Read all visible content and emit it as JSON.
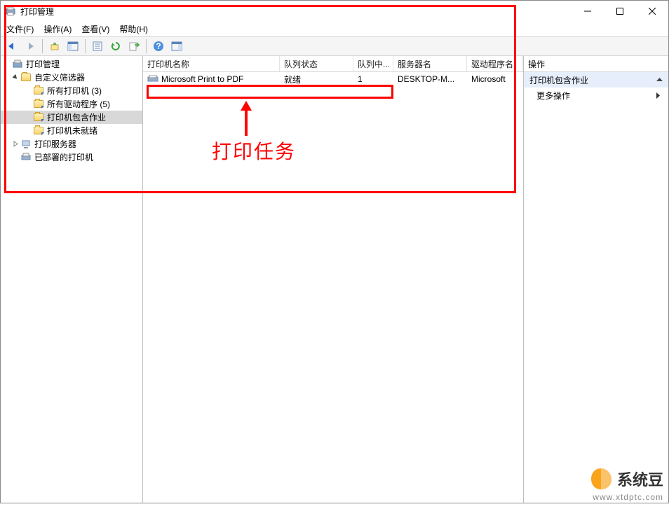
{
  "window": {
    "title": "打印管理"
  },
  "menu": {
    "file": "文件(F)",
    "action": "操作(A)",
    "view": "查看(V)",
    "help": "帮助(H)"
  },
  "tree": {
    "root": "打印管理",
    "custom_filters": "自定义筛选器",
    "all_printers": "所有打印机 (3)",
    "all_drivers": "所有驱动程序 (5)",
    "printers_with_jobs": "打印机包含作业",
    "printers_not_ready": "打印机未就绪",
    "print_servers": "打印服务器",
    "deployed_printers": "已部署的打印机"
  },
  "list": {
    "columns": {
      "name": "打印机名称",
      "queue_status": "队列状态",
      "queue_jobs": "队列中...",
      "server": "服务器名",
      "driver": "驱动程序名"
    },
    "row": {
      "name": "Microsoft Print to PDF",
      "status": "就绪",
      "jobs": "1",
      "server": "DESKTOP-M...",
      "driver": "Microsoft"
    }
  },
  "actions": {
    "header": "操作",
    "section": "打印机包含作业",
    "more": "更多操作"
  },
  "annotation": {
    "label": "打印任务"
  },
  "watermark": {
    "brand": "系统豆",
    "url": "www.xtdptc.com"
  }
}
